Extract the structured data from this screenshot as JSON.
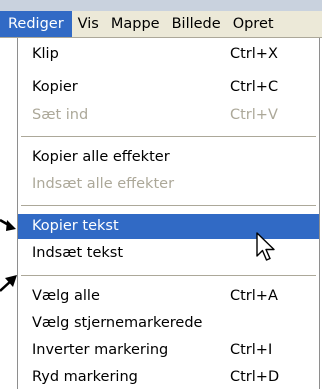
{
  "menubar": {
    "items": [
      "Rediger",
      "Vis",
      "Mappe",
      "Billede",
      "Opret"
    ]
  },
  "menu": {
    "items": [
      {
        "label": "Klip",
        "shortcut": "Ctrl+X",
        "state": "enabled"
      },
      {
        "label": "Kopier",
        "shortcut": "Ctrl+C",
        "state": "enabled"
      },
      {
        "label": "Sæt ind",
        "shortcut": "Ctrl+V",
        "state": "disabled"
      },
      {
        "label": "Kopier alle effekter",
        "shortcut": "",
        "state": "enabled"
      },
      {
        "label": "Indsæt alle effekter",
        "shortcut": "",
        "state": "disabled"
      },
      {
        "label": "Kopier tekst",
        "shortcut": "",
        "state": "highlighted"
      },
      {
        "label": "Indsæt tekst",
        "shortcut": "",
        "state": "enabled"
      },
      {
        "label": "Vælg alle",
        "shortcut": "Ctrl+A",
        "state": "enabled"
      },
      {
        "label": "Vælg stjernemarkerede",
        "shortcut": "",
        "state": "enabled"
      },
      {
        "label": "Inverter markering",
        "shortcut": "Ctrl+I",
        "state": "enabled"
      },
      {
        "label": "Ryd markering",
        "shortcut": "Ctrl+D",
        "state": "enabled"
      }
    ]
  },
  "colors": {
    "highlight": "#316ac5",
    "disabled_text": "#aca899",
    "menubar_bg": "#ece9d8"
  },
  "icons": [
    "pointer-arrow-icon",
    "mouse-cursor-icon"
  ]
}
